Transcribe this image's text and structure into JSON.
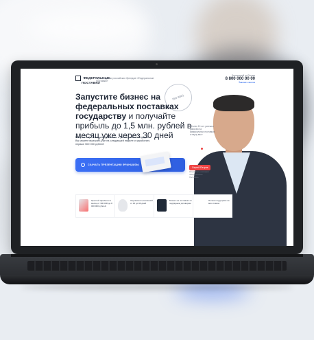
{
  "header": {
    "logo_line1": "ФЕДЕРАЛЬНЫЕ",
    "logo_line2": "ПОСТАВКИ",
    "tagline": "Производство российских брендов «Федеральные Поставки»",
    "phone_caption": "Бесплатный по России",
    "phone": "8 800 000 00 00",
    "callback": "Заказать звонок"
  },
  "hero": {
    "headline_bold": "Запустите бизнес на федеральных поставках государству",
    "headline_rest": " и получайте прибыль до 1,5 млн. рублей в месяц уже через 30 дней",
    "subtext": "Получите презентацию франшизы и узнайте какие тендеры Вы можете выиграть уже на следующей неделе и заработать первые 500 000 рублей",
    "cta_label": "СКАЧАТЬ ПРЕЗЕНТАЦИЮ ФРАНШИЗЫ",
    "stamp": "ISO 9001"
  },
  "person": {
    "quote": "«Более 10 лет успешно работаю на федеральных поставках и научу вас»",
    "name": "Сергей Петров",
    "role": "Основатель компании «Федеральные Поставки»"
  },
  "features": [
    {
      "text": "Простой заработок в месяц от 300 000 до 8 000 000 рублей"
    },
    {
      "text": "Окупаемость вложений от 30 до 90 дней"
    },
    {
      "text": "Бизнес на поставках по подрядным договорам"
    },
    {
      "text": "Полная поддержка на всех этапах"
    }
  ],
  "colors": {
    "accent": "#2f5fe0",
    "text": "#1c2433",
    "laptop": "#1f2124",
    "name_tag": "#ef4444"
  }
}
